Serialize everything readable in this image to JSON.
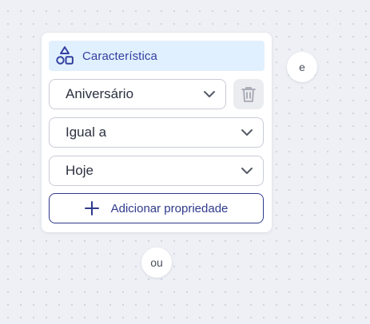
{
  "card": {
    "header": {
      "title": "Característica",
      "icon": "shapes-icon"
    },
    "property_select": {
      "value": "Aniversário"
    },
    "operator_select": {
      "value": "Igual a"
    },
    "value_select": {
      "value": "Hoje"
    },
    "delete_icon": "trash-icon",
    "add_property_button": {
      "label": "Adicionar propriedade",
      "icon": "plus-icon"
    }
  },
  "connectors": {
    "and_label": "e",
    "or_label": "ou"
  },
  "colors": {
    "accent": "#3440a0",
    "header_bg": "#e1f0fe",
    "canvas_bg": "#eef0f5"
  }
}
